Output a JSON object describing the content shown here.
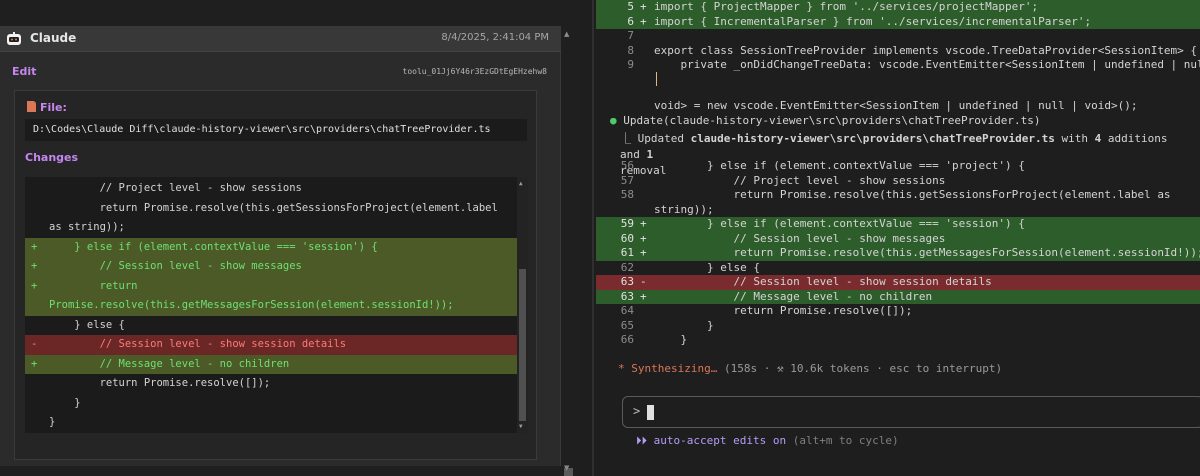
{
  "chat": {
    "author": "Claude",
    "timestamp": "8/4/2025, 2:41:04 PM",
    "tool": {
      "name": "Edit",
      "id": "toolu_01Jj6Y46r3EzGDtEgEHzehw8"
    },
    "file_label": "File:",
    "file_path": "D:\\Codes\\Claude Diff\\claude-history-viewer\\src\\providers\\chatTreeProvider.ts",
    "changes_label": "Changes",
    "diff_lines": [
      {
        "type": "ctx",
        "sign": "",
        "text": "        // Project level - show sessions"
      },
      {
        "type": "ctx",
        "sign": "",
        "text": "        return Promise.resolve(this.getSessionsForProject(element.label"
      },
      {
        "type": "ctx",
        "sign": "",
        "text": "as string));"
      },
      {
        "type": "add",
        "sign": "+",
        "text": "    } else if (element.contextValue === 'session') {"
      },
      {
        "type": "add",
        "sign": "+",
        "text": "        // Session level - show messages"
      },
      {
        "type": "add",
        "sign": "+",
        "text": "        return"
      },
      {
        "type": "add",
        "sign": "",
        "text": "Promise.resolve(this.getMessagesForSession(element.sessionId!));"
      },
      {
        "type": "ctx",
        "sign": "",
        "text": "    } else {"
      },
      {
        "type": "del",
        "sign": "-",
        "text": "        // Session level - show session details"
      },
      {
        "type": "add",
        "sign": "+",
        "text": "        // Message level - no children"
      },
      {
        "type": "ctx",
        "sign": "",
        "text": "        return Promise.resolve([]);"
      },
      {
        "type": "ctx",
        "sign": "",
        "text": "    }"
      },
      {
        "type": "ctx",
        "sign": "",
        "text": "}"
      }
    ]
  },
  "terminal": {
    "top_lines": [
      {
        "type": "add",
        "ln": "5",
        "sign": "+",
        "text": "import { ProjectMapper } from '../services/projectMapper';"
      },
      {
        "type": "add",
        "ln": "6",
        "sign": "+",
        "text": "import { IncrementalParser } from '../services/incrementalParser';"
      },
      {
        "type": "ctx",
        "ln": "7",
        "sign": "",
        "text": ""
      },
      {
        "type": "ctx",
        "ln": "8",
        "sign": "",
        "text": "export class SessionTreeProvider implements vscode.TreeDataProvider<SessionItem> {"
      },
      {
        "type": "ctx",
        "ln": "9",
        "sign": "",
        "text": "    private _onDidChangeTreeData: vscode.EventEmitter<SessionItem | undefined | null"
      }
    ],
    "wrap_line": "void> = new vscode.EventEmitter<SessionItem | undefined | null | void>();",
    "update": {
      "verb": "Update",
      "path": "(claude-history-viewer\\src\\providers\\chatTreeProvider.ts)",
      "summary_prefix": "Updated ",
      "summary_path": "claude-history-viewer\\src\\providers\\chatTreeProvider.ts",
      "summary_mid": " with ",
      "additions": "4",
      "summary_and": " additions and ",
      "removals": "1",
      "summary_end": "removal"
    },
    "diff_lines": [
      {
        "type": "ctx",
        "ln": "56",
        "sign": "",
        "text": "        } else if (element.contextValue === 'project') {"
      },
      {
        "type": "ctx",
        "ln": "57",
        "sign": "",
        "text": "            // Project level - show sessions"
      },
      {
        "type": "ctx",
        "ln": "58",
        "sign": "",
        "text": "            return Promise.resolve(this.getSessionsForProject(element.label as"
      },
      {
        "type": "ctx",
        "ln": "",
        "sign": "",
        "text": "string));"
      },
      {
        "type": "add",
        "ln": "59",
        "sign": "+",
        "text": "        } else if (element.contextValue === 'session') {"
      },
      {
        "type": "add",
        "ln": "60",
        "sign": "+",
        "text": "            // Session level - show messages"
      },
      {
        "type": "add",
        "ln": "61",
        "sign": "+",
        "text": "            return Promise.resolve(this.getMessagesForSession(element.sessionId!));"
      },
      {
        "type": "ctx",
        "ln": "62",
        "sign": "",
        "text": "        } else {"
      },
      {
        "type": "del",
        "ln": "63",
        "sign": "-",
        "text": "            // Session level - show session details"
      },
      {
        "type": "add",
        "ln": "63",
        "sign": "+",
        "text": "            // Message level - no children"
      },
      {
        "type": "ctx",
        "ln": "64",
        "sign": "",
        "text": "            return Promise.resolve([]);"
      },
      {
        "type": "ctx",
        "ln": "65",
        "sign": "",
        "text": "        }"
      },
      {
        "type": "ctx",
        "ln": "66",
        "sign": "",
        "text": "    }"
      }
    ],
    "status": {
      "icon": "*",
      "label": "Synthesizing…",
      "detail": " (158s · ⚒ 10.6k tokens · esc to interrupt)"
    },
    "prompt_caret": ">",
    "accept": {
      "icon": "⏵⏵",
      "label": " auto-accept edits on",
      "hint": " (alt+m to cycle)"
    }
  },
  "colors": {
    "accent_purple": "#c586f0",
    "claude_orange": "#d97757",
    "diff_add_bg": "#4b5a26",
    "diff_del_bg": "#6b2626",
    "term_add_bg": "#2d5d2a",
    "term_del_bg": "#7a2b2d"
  }
}
